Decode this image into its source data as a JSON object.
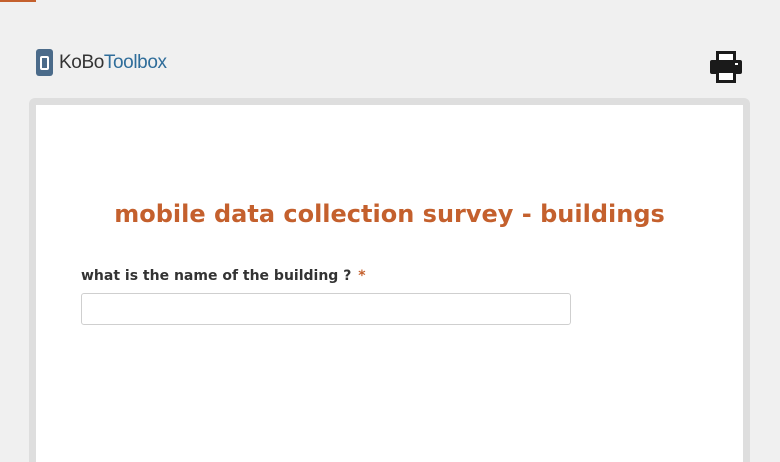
{
  "header": {
    "logo_kobo": "KoBo",
    "logo_toolbox": "Toolbox",
    "print_icon": "print-icon"
  },
  "form": {
    "title": "mobile data collection survey - buildings",
    "questions": [
      {
        "label": "what is the name of the building ?",
        "required_marker": "*",
        "value": "",
        "placeholder": ""
      }
    ]
  },
  "colors": {
    "accent": "#c4602d",
    "logo_blue": "#2f6d9a",
    "background": "#f0f0f0",
    "frame": "#dedede"
  }
}
